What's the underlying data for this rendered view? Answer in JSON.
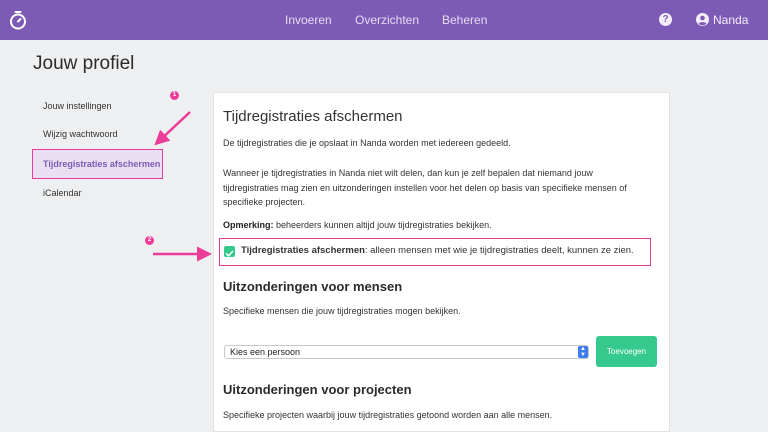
{
  "header": {
    "nav": [
      "Invoeren",
      "Overzichten",
      "Beheren"
    ],
    "help_label": "?",
    "user_name": "Nanda"
  },
  "page_title": "Jouw profiel",
  "sidebar": {
    "items": [
      {
        "label": "Jouw instellingen"
      },
      {
        "label": "Wijzig wachtwoord"
      },
      {
        "label": "Tijdregistraties afschermen",
        "active": true
      },
      {
        "label": "iCalendar"
      }
    ]
  },
  "main": {
    "title": "Tijdregistraties afschermen",
    "p1": "De tijdregistraties die je opslaat in Nanda worden met iedereen gedeeld.",
    "p2_line1": "Wanneer je tijdregistraties in Nanda niet wilt delen, dan kun je zelf bepalen dat niemand jouw",
    "p2_line2": "tijdregistraties mag zien en uitzonderingen instellen voor het delen op basis van specifieke mensen of",
    "p2_line3": "specifieke projecten.",
    "note_bold": "Opmerking:",
    "note_text": " beheerders kunnen altijd jouw tijdregistraties bekijken.",
    "checkbox": {
      "checked": true,
      "label_bold": "Tijdregistraties afschermen",
      "label_text": ": alleen mensen met wie je tijdregistraties deelt, kunnen ze zien."
    },
    "people_section": {
      "title": "Uitzonderingen voor mensen",
      "description": "Specifieke mensen die jouw tijdregistraties mogen bekijken.",
      "select_value": "Kies een persoon",
      "add_button": "Toevoegen"
    },
    "projects_section": {
      "title": "Uitzonderingen voor projecten",
      "description": "Specifieke projecten waarbij jouw tijdregistraties getoond worden aan alle mensen."
    }
  },
  "annotations": {
    "badge1": "1",
    "badge2": "2"
  },
  "colors": {
    "header_bg": "#7d5ab5",
    "accent_green": "#35c98e",
    "annotation_pink": "#ec3c9a"
  }
}
